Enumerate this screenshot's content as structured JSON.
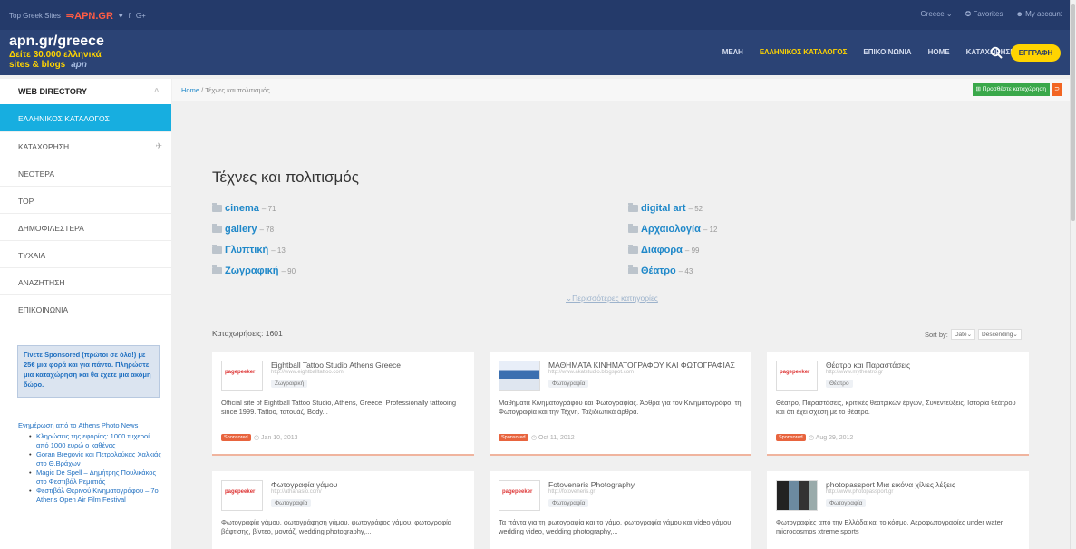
{
  "topbar": {
    "label": "Top Greek Sites",
    "brand": "⇒APN.GR",
    "social": [
      "♥",
      "f",
      "G+"
    ],
    "region": "Greece ⌄",
    "favorites": "Favorites",
    "account": "My account"
  },
  "logo": {
    "line1": "apn.gr/greece",
    "line2": "Δείτε 30.000 ελληνικά",
    "line3": "sites & blogs",
    "apn": "apn"
  },
  "nav": {
    "items": [
      "ΜΕΛΗ",
      "ΕΛΛΗΝΙΚΟΣ ΚΑΤΑΛΟΓΟΣ",
      "ΕΠΙΚΟΙΝΩΝΙΑ",
      "HOME",
      "ΚΑΤΑΧΩΡΗΣΗ"
    ],
    "signup": "ΕΓΓΡΑΦΗ"
  },
  "sidebar": {
    "title": "WEB DIRECTORY",
    "chevron": "^",
    "items": [
      "ΕΛΛΗΝΙΚΟΣ ΚΑΤΑΛΟΓΟΣ",
      "ΚΑΤΑΧΩΡΗΣΗ",
      "ΝΕΟΤΕΡΑ",
      "TOP",
      "ΔΗΜΟΦΙΛΕΣΤΕΡΑ",
      "ΤΥΧΑΙΑ",
      "ΑΝΑΖΗΤΗΣΗ",
      "ΕΠΙΚΟΙΝΩΝΙΑ"
    ],
    "sponsor_prefix": "Γίνετε Sponsored (πρώτοι σε όλα!) με 25€ μια φορά και για πάντα. Πληρώστε μια καταχώρηση και θα έχετε μια ακόμη δώρο.",
    "news_head": "Ενημέρωση από το Athens Photo News",
    "news": [
      "Κληρώσεις της εφορίας: 1000 τυχεροί από 1000 ευρώ ο καθένας",
      "Goran Bregovic και Πετρολούκας Χαλκιάς στο Θ.Βράχων",
      "Magic De Spell – Δημήτρης Πουλικάκος στο Φεστιβάλ Ρεματιάς",
      "Φεστιβάλ Θερινού Κινηματογράφου – 7ο Athens Open Air Film Festival"
    ]
  },
  "breadcrumb": {
    "home": "Home",
    "sep": "/",
    "current": "Τέχνες και πολιτισμός"
  },
  "actions": {
    "add": "Προσθέστε καταχώρηση",
    "rss": "⊃"
  },
  "page": {
    "title": "Τέχνες και πολιτισμός",
    "more": "⌄Περισσότερες κατηγορίες"
  },
  "categories": [
    {
      "name": "cinema",
      "count": "– 71"
    },
    {
      "name": "digital art",
      "count": "– 52"
    },
    {
      "name": "gallery",
      "count": "– 78"
    },
    {
      "name": "Αρχαιολογία",
      "count": "– 12"
    },
    {
      "name": "Γλυπτική",
      "count": "– 13"
    },
    {
      "name": "Διάφορα",
      "count": "– 99"
    },
    {
      "name": "Ζωγραφική",
      "count": "– 90"
    },
    {
      "name": "Θέατρο",
      "count": "– 43"
    }
  ],
  "listing": {
    "count": "Καταχωρήσεις: 1601",
    "sort_label": "Sort by:",
    "sort_by": "Date⌄",
    "sort_dir": "Descending⌄"
  },
  "cards": [
    {
      "title": "Eightball Tattoo Studio Athens Greece",
      "url": "http://www.eightballtattoo.com",
      "tag": "Ζωγραφική",
      "desc": "Official site of Eightball Tattoo Studio, Athens, Greece. Professionally tattooing since 1999. Tattoo, τατουάζ, Body...",
      "badge": "Sponsored",
      "date": "◷ Jan 10, 2013"
    },
    {
      "title": "ΜΑΘΗΜΑΤΑ ΚΙΝΗΜΑΤΟΓΡΑΦΟΥ ΚΑΙ ΦΩΤΟΓΡΑΦΙΑΣ",
      "url": "http://www.akatstudio.blogspot.com",
      "tag": "Φωτογραφία",
      "desc": "Μαθήματα Κινηματογράφου και Φωτογραφίας. Άρθρα για τον Κινηματογράφο, τη Φωτογραφία και την Τέχνη. Ταξιδιωτικά άρθρα.",
      "badge": "Sponsored",
      "date": "◷ Oct 11, 2012"
    },
    {
      "title": "Θέατρο και Παραστάσεις",
      "url": "http://www.mytheatro.gr",
      "tag": "Θέατρο",
      "desc": "Θέατρο, Παραστάσεις, κριτικές θεατρικών έργων, Συνεντεύξεις, Ιστορία θεάτρου και ότι έχει σχέση με το θέατρο.",
      "badge": "Sponsored",
      "date": "◷ Aug 29, 2012"
    },
    {
      "title": "Φωτογραφία γάμου",
      "url": "http://athanasio.com/",
      "tag": "Φωτογραφία",
      "desc": "Φωτογραφία γάμου, φωτογράφηση γάμου, φωτογράφος γάμου, φωτογραφία βάφτισης, βίντεο, μοντάζ, wedding photography,...",
      "badge": "",
      "date": ""
    },
    {
      "title": "Fotoveneris Photography",
      "url": "http://fotoveneris.gr",
      "tag": "Φωτογραφία",
      "desc": "Τα πάντα για τη φωτογραφία και το γάμο, φωτογραφία γάμου και video γάμου, wedding video, wedding photography,...",
      "badge": "",
      "date": ""
    },
    {
      "title": "photopassport Μια εικόνα χίλιες λέξεις",
      "url": "http://www.photopassport.gr",
      "tag": "Φωτογραφία",
      "desc": "Φωτογραφίες από την Ελλάδα και το κόσμο. Αεροφωτογραφίες under water microcosmos xtreme sports",
      "badge": "",
      "date": ""
    }
  ],
  "thumb_logo": {
    "a": "page",
    "b": "peeker"
  }
}
